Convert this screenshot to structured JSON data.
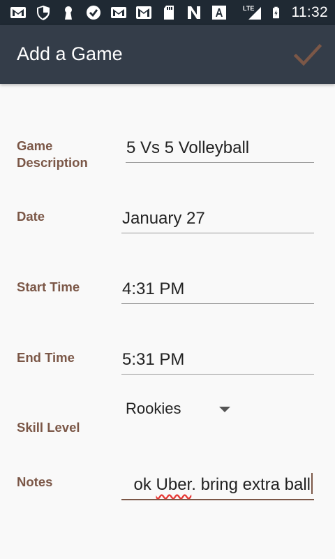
{
  "status_bar": {
    "time": "11:32",
    "network_label": "LTE",
    "icons": [
      "gmail-icon",
      "shield-icon",
      "keyhole-icon",
      "check-bubble-icon",
      "gmail-icon",
      "photo-mail-icon",
      "sd-card-icon",
      "n-icon",
      "font-icon",
      "signal-icon",
      "battery-icon"
    ]
  },
  "app_bar": {
    "title": "Add a Game",
    "confirm_icon": "checkmark-icon",
    "confirm_color": "#7b5747"
  },
  "form": {
    "game_description": {
      "label_line1": "Game",
      "label_line2": "Description",
      "value": "5 Vs 5 Volleyball"
    },
    "date": {
      "label": "Date",
      "value": "January 27"
    },
    "start_time": {
      "label": "Start Time",
      "value": "4:31 PM"
    },
    "end_time": {
      "label": "End Time",
      "value": "5:31 PM"
    },
    "skill_level": {
      "label": "Skill Level",
      "value": "Rookies"
    },
    "notes": {
      "label": "Notes",
      "value_pre": "ok ",
      "value_misspelled": "Uber",
      "value_post": ". bring extra ball"
    }
  },
  "colors": {
    "status_bar": "#1f2933",
    "app_bar": "#343d49",
    "label": "#7b5747",
    "background": "#f9f9f9"
  }
}
